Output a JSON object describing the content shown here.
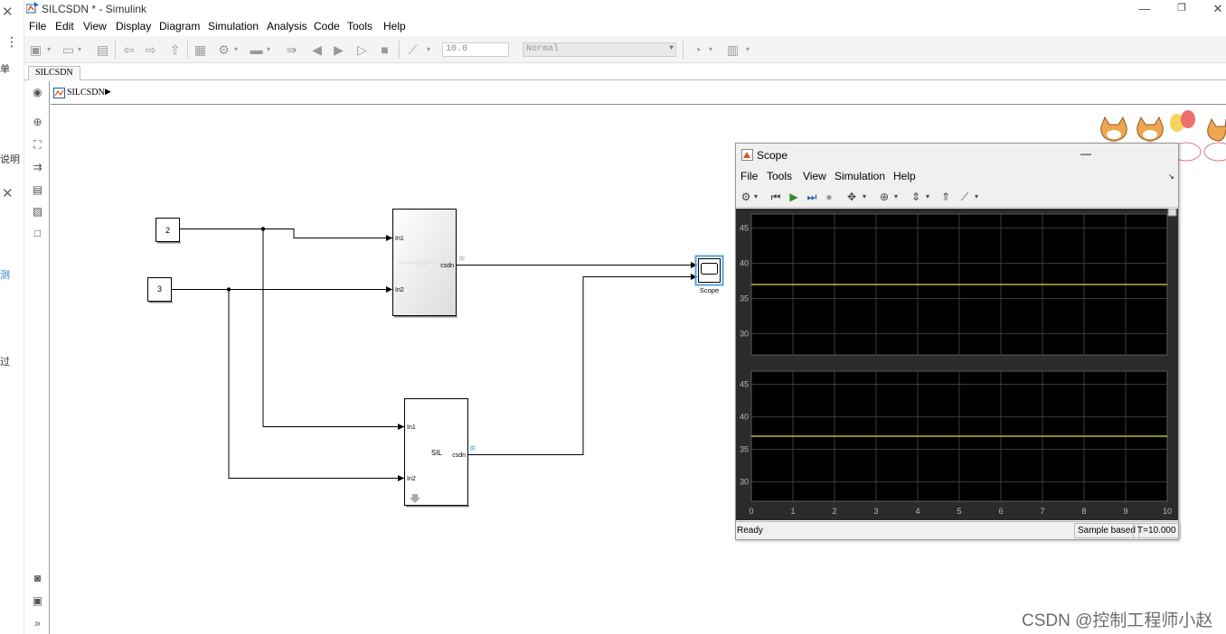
{
  "app": {
    "title": "SILCSDN * - Simulink"
  },
  "left_strip": {
    "items": [
      "单",
      "说明",
      "测",
      "过"
    ]
  },
  "menubar": [
    "File",
    "Edit",
    "View",
    "Display",
    "Diagram",
    "Simulation",
    "Analysis",
    "Code",
    "Tools",
    "Help"
  ],
  "toolbar": {
    "stop_time": "10.0",
    "sim_mode": "Normal"
  },
  "tab": {
    "label": "SILCSDN"
  },
  "breadcrumb": {
    "model": "SILCSDN"
  },
  "diagram": {
    "const_top": "2",
    "const_bottom": "3",
    "subsystem1": {
      "in1": "In1",
      "in2": "In2",
      "out": "csdn"
    },
    "subsystem2": {
      "label": "SIL",
      "in1": "In1",
      "in2": "In2",
      "out": "csdn"
    },
    "scope_block": "Scope"
  },
  "scope_window": {
    "title": "Scope",
    "menu": [
      "File",
      "Tools",
      "View",
      "Simulation",
      "Help"
    ],
    "status": {
      "ready": "Ready",
      "sample": "Sample based",
      "time": "T=10.000"
    },
    "line_color": "#e6d84a",
    "plots": [
      {
        "yticks": [
          "45",
          "40",
          "35",
          "30"
        ],
        "ylim": [
          27,
          47
        ],
        "value": 37
      },
      {
        "yticks": [
          "45",
          "40",
          "35",
          "30"
        ],
        "ylim": [
          27,
          47
        ],
        "value": 37
      }
    ],
    "xticks": [
      "0",
      "1",
      "2",
      "3",
      "4",
      "5",
      "6",
      "7",
      "8",
      "9",
      "10"
    ]
  },
  "watermark": "CSDN @控制工程师小赵"
}
